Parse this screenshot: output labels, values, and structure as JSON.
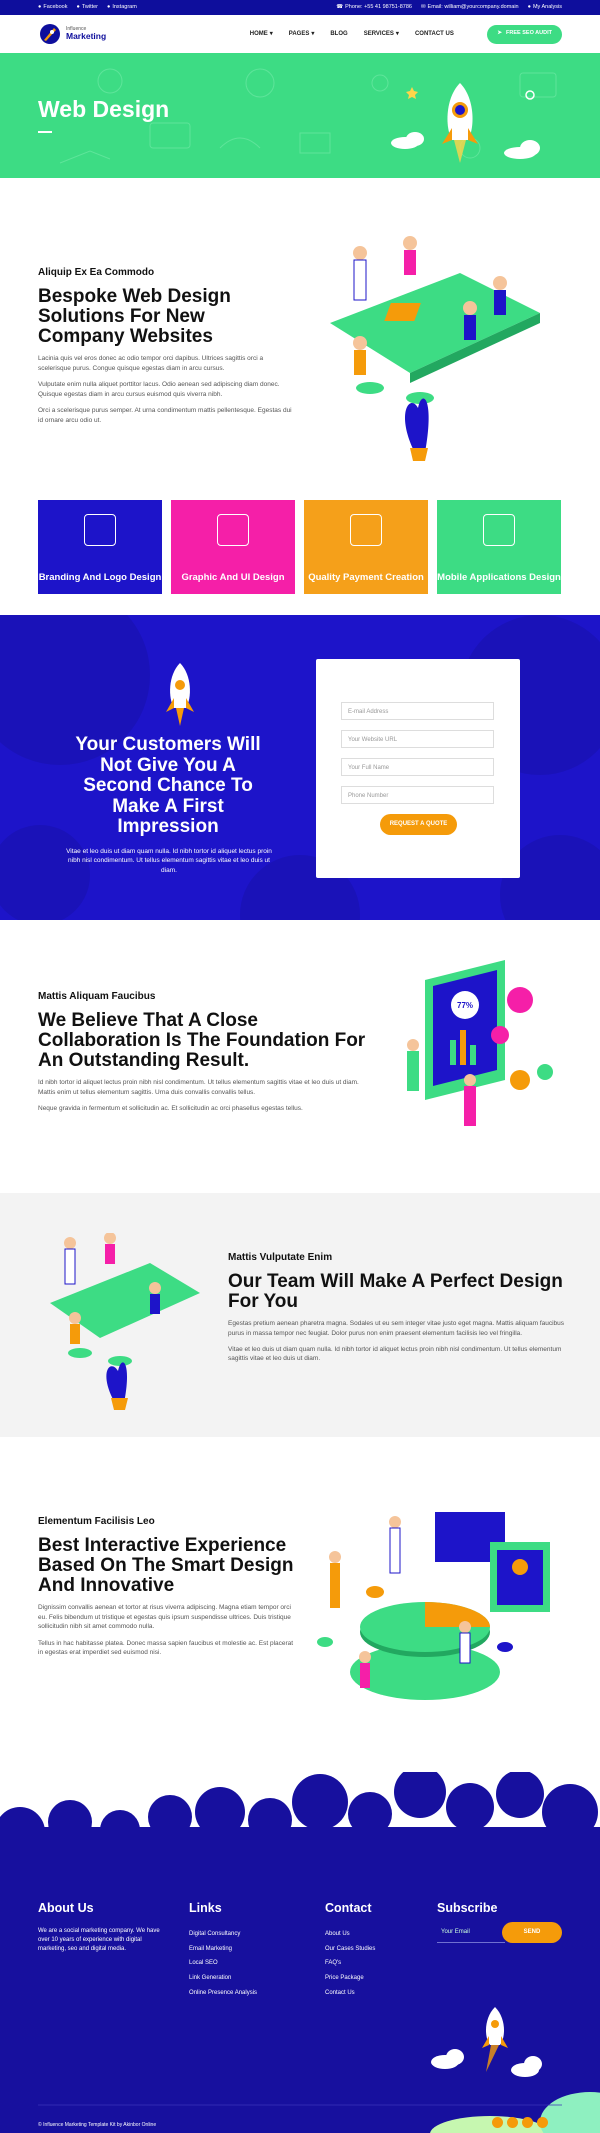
{
  "topbar": {
    "facebook": "Facebook",
    "twitter": "Twitter",
    "instagram": "Instagram",
    "phone": "Phone: +55 41 98751-8786",
    "email": "Email: william@yourcompany.domain",
    "account": "My Analysis"
  },
  "nav": {
    "logo_small": "Influence",
    "logo_big": "Marketing",
    "items": [
      "HOME",
      "PAGES",
      "BLOG",
      "SERVICES",
      "CONTACT US"
    ],
    "cta": "FREE SEO AUDIT"
  },
  "hero": {
    "title": "Web Design"
  },
  "about": {
    "label": "Aliquip Ex Ea Commodo",
    "title": "Bespoke Web Design Solutions For New Company Websites",
    "p1": "Lacinia quis vel eros donec ac odio tempor orci dapibus. Ultrices sagittis orci a scelerisque purus. Congue quisque egestas diam in arcu cursus.",
    "p2": "Vulputate enim nulla aliquet porttitor lacus. Odio aenean sed adipiscing diam donec. Quisque egestas diam in arcu cursus euismod quis viverra nibh.",
    "p3": "Orci a scelerisque purus semper. At urna condimentum mattis pellentesque. Egestas dui id ornare arcu odio ut."
  },
  "services": [
    {
      "label": "Branding And Logo Design",
      "color": "#1d14c9"
    },
    {
      "label": "Graphic And UI Design",
      "color": "#f51fa8"
    },
    {
      "label": "Quality Payment Creation",
      "color": "#f5a01a"
    },
    {
      "label": "Mobile Applications Design",
      "color": "#3ddc84"
    }
  ],
  "quote": {
    "title": "Your Customers Will Not Give You A Second Chance To Make A First Impression",
    "text": "Vitae et leo duis ut diam quam nulla. Id nibh tortor id aliquet lectus proin nibh nisl condimentum. Ut tellus elementum sagittis vitae et leo duis ut diam.",
    "fields": [
      "E-mail Address",
      "Your Website URL",
      "Your Full Name",
      "Phone Number"
    ],
    "button": "REQUEST A QUOTE"
  },
  "collab": {
    "label": "Mattis Aliquam Faucibus",
    "title": "We Believe That A Close Collaboration Is The Foundation For An Outstanding Result.",
    "p1": "Id nibh tortor id aliquet lectus proin nibh nisl condimentum. Ut tellus elementum sagittis vitae et leo duis ut diam. Mattis enim ut tellus elementum sagittis. Urna duis convallis convallis tellus.",
    "p2": "Neque gravida in fermentum et sollicitudin ac. Et sollicitudin ac orci phasellus egestas tellus.",
    "stat": "77%"
  },
  "team": {
    "label": "Mattis Vulputate Enim",
    "title": "Our Team Will Make A Perfect Design For You",
    "p1": "Egestas pretium aenean pharetra magna. Sodales ut eu sem integer vitae justo eget magna. Mattis aliquam faucibus purus in massa tempor nec feugiat. Dolor purus non enim praesent elementum facilisis leo vel fringilla.",
    "p2": "Vitae et leo duis ut diam quam nulla. Id nibh tortor id aliquet lectus proin nibh nisl condimentum. Ut tellus elementum sagittis vitae et leo duis ut diam."
  },
  "interactive": {
    "label": "Elementum Facilisis Leo",
    "title": "Best Interactive Experience Based On The Smart Design And Innovative",
    "p1": "Dignissim convallis aenean et tortor at risus viverra adipiscing. Magna etiam tempor orci eu. Felis bibendum ut tristique et egestas quis ipsum suspendisse ultrices. Duis tristique sollicitudin nibh sit amet commodo nulla.",
    "p2": "Tellus in hac habitasse platea. Donec massa sapien faucibus et molestie ac. Est placerat in egestas erat imperdiet sed euismod nisi."
  },
  "footer": {
    "about_title": "About Us",
    "about_text": "We are a social marketing company. We have over 10 years of experience with digital marketing, seo and digital media.",
    "links_title": "Links",
    "links": [
      "Digital Consultancy",
      "Email Marketing",
      "Local SEO",
      "Link Generation",
      "Online Presence Analysis"
    ],
    "contact_title": "Contact",
    "contact": [
      "About Us",
      "Our Cases Studies",
      "FAQ's",
      "Price Package",
      "Contact Us"
    ],
    "subscribe_title": "Subscribe",
    "email_placeholder": "Your Email",
    "send": "SEND",
    "copyright": "© Influence Marketing Template Kit by Akinbor Online"
  }
}
